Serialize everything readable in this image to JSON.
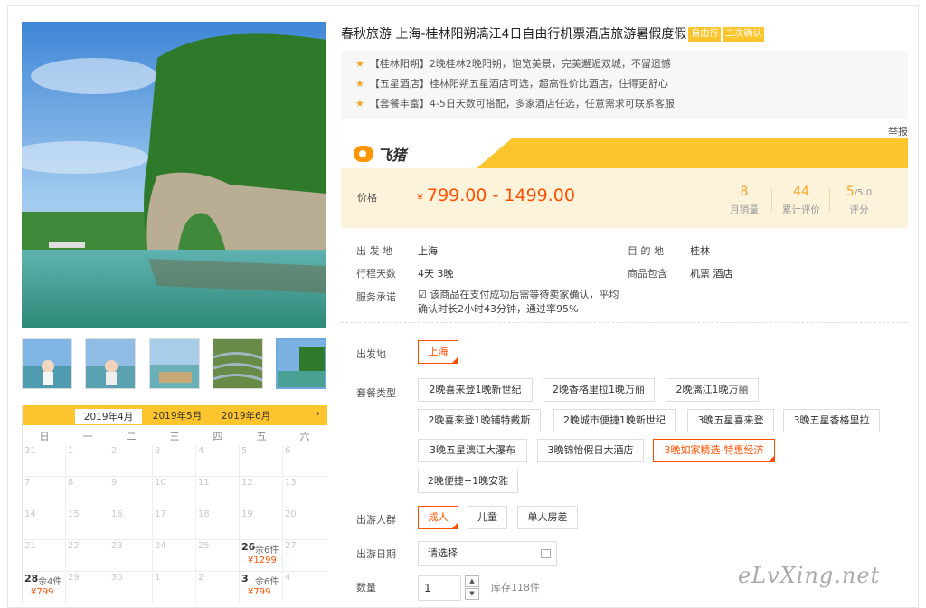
{
  "product": {
    "title": "春秋旅游 上海-桂林阳朔漓江4日自由行机票酒店旅游暑假度假",
    "tags": [
      "自由行",
      "二次确认"
    ],
    "highlights": [
      "【桂林阳朔】2晚桂林2晚阳朔，饱览美景，完美邂逅双城，不留遗憾",
      "【五星酒店】桂林阳朔五星酒店可选，超高性价比酒店，住得更舒心",
      "【套餐丰富】4-5日天数可搭配，多家酒店任选，任意需求可联系客服"
    ],
    "report_label": "举报",
    "brand": "飞猪"
  },
  "price": {
    "label": "价格",
    "currency": "¥",
    "range": "799.00 - 1499.00",
    "stats": [
      {
        "value": "8",
        "suffix": "",
        "label": "月销量"
      },
      {
        "value": "44",
        "suffix": "",
        "label": "累计评价"
      },
      {
        "value": "5",
        "suffix": "/5.0",
        "label": "评分"
      }
    ]
  },
  "info": {
    "departure_label": "出 发 地",
    "departure": "上海",
    "destination_label": "目 的 地",
    "destination": "桂林",
    "duration_label": "行程天数",
    "duration": "4天  3晚",
    "includes_label": "商品包含",
    "includes": "机票  酒店",
    "promise_label": "服务承诺",
    "promise": "该商品在支付成功后需等待卖家确认，平均确认时长2小时43分钟，通过率95%"
  },
  "options": {
    "departure_label": "出发地",
    "departure_values": [
      "上海"
    ],
    "package_label": "套餐类型",
    "packages": [
      "2晚喜来登1晚新世纪",
      "2晚香格里拉1晚万丽",
      "2晚漓江1晚万丽",
      "2晚喜来登1晚铺特戴斯",
      "2晚城市便捷1晚新世纪",
      "3晚五星喜来登",
      "3晚五星香格里拉",
      "3晚五星漓江大瀑布",
      "3晚锦怡假日大酒店",
      "3晚如家精选-特惠经济",
      "2晚便捷+1晚安雅"
    ],
    "package_selected": "3晚如家精选-特惠经济",
    "traveler_label": "出游人群",
    "travelers": [
      "成人",
      "儿童",
      "单人房差"
    ],
    "traveler_selected": "成人",
    "date_label": "出游日期",
    "date_placeholder": "请选择",
    "qty_label": "数量",
    "qty_value": "1",
    "stock": "库存118件"
  },
  "calendar": {
    "months": [
      "2019年4月",
      "2019年5月",
      "2019年6月"
    ],
    "active_month": "2019年4月",
    "next_icon": "chevron-right-icon",
    "weekdays": [
      "日",
      "一",
      "二",
      "三",
      "四",
      "五",
      "六"
    ],
    "days": [
      "31",
      "1",
      "2",
      "3",
      "4",
      "5",
      "6",
      "7",
      "8",
      "9",
      "10",
      "11",
      "12",
      "13",
      "14",
      "15",
      "16",
      "17",
      "18",
      "19",
      "20",
      "21",
      "22",
      "23",
      "24",
      "25",
      "26",
      "27",
      "28",
      "29",
      "30",
      "1",
      "2",
      "3",
      "4"
    ],
    "specials": {
      "26": {
        "stock": "余6件",
        "price": "¥1299"
      },
      "28": {
        "stock": "余4件",
        "price": "¥799"
      },
      "3": {
        "stock": "余6件",
        "price": "¥799"
      }
    }
  },
  "watermark": "eLvXing.net",
  "colors": {
    "accent": "#fcc42d",
    "price": "#ff5000",
    "highlight_bg": "#f7f7f7",
    "price_bg": "#fdf3da"
  }
}
